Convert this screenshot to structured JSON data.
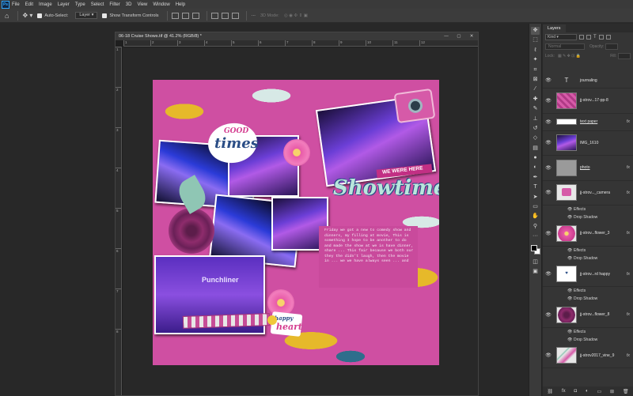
{
  "app": {
    "logo": "Ps",
    "accent": "#31a8ff"
  },
  "menu": [
    "File",
    "Edit",
    "Image",
    "Layer",
    "Type",
    "Select",
    "Filter",
    "3D",
    "View",
    "Window",
    "Help"
  ],
  "options_bar": {
    "auto_select_label": "Auto-Select:",
    "auto_select_value": "Layer",
    "transform_label": "Show Transform Controls",
    "mode_3d": "3D Mode:"
  },
  "document": {
    "tab_title": "06-18 Cruise Shows.tif @ 41.2% (RGB/8) *",
    "ruler_h": [
      "1",
      "2",
      "3",
      "4",
      "5",
      "6",
      "7",
      "8",
      "9",
      "10",
      "11",
      "12"
    ],
    "ruler_v": [
      "1",
      "2",
      "3",
      "4",
      "5",
      "6",
      "7",
      "8"
    ]
  },
  "canvas": {
    "sticker_good": "GOOD",
    "sticker_times": "times",
    "sticker_we_were_here": "WE WERE HERE",
    "sticker_showtime": "Showtime",
    "sign_punchliner": "Punchliner",
    "sticker_happy": "happy",
    "sticker_heart": "heart",
    "journal_text": "Friday we got a new to comedy show and dinners, my filling at movie, This is something I hope to be another to do and made the show at we is have dinner, share ... This fair because we both our they the didn't laugh, then the movie in ... we we have always seen ... and",
    "colors": {
      "pink": "#cf4fa2",
      "yellow": "#e6b92a",
      "teal": "#2e6e8c",
      "mint": "#d7e9e6"
    }
  },
  "layers_panel": {
    "tab": "Layers",
    "filter_kind": "Kind",
    "blend_mode": "Normal",
    "opacity_label": "Opacity:",
    "lock_label": "Lock:",
    "fill_label": "Fill:",
    "layers": [
      {
        "name": "journaling",
        "type": "text",
        "fx": ""
      },
      {
        "name": "jj-strov...17-pp-8",
        "type": "paper",
        "fx": ""
      },
      {
        "name": "text paper",
        "type": "white",
        "fx": "fx"
      },
      {
        "name": "IMG_1610",
        "type": "photo",
        "fx": ""
      },
      {
        "name": "photo",
        "type": "gray",
        "fx": "fx"
      },
      {
        "name": "jj-strov..._camera",
        "type": "camera",
        "fx": "fx",
        "effects": [
          "Effects",
          "Drop Shadow"
        ]
      },
      {
        "name": "jj-strov...flower_3",
        "type": "flower",
        "fx": "fx",
        "effects": [
          "Effects",
          "Drop Shadow"
        ]
      },
      {
        "name": "jj-strov...rd happy",
        "type": "happy",
        "fx": "fx",
        "effects": [
          "Effects",
          "Drop Shadow"
        ]
      },
      {
        "name": "jj-strov...flower_8",
        "type": "rose",
        "fx": "fx",
        "effects": [
          "Effects",
          "Drop Shadow"
        ]
      },
      {
        "name": "jj-strov2017_vine_9",
        "type": "vine",
        "fx": "fx"
      }
    ]
  },
  "tool_icons": [
    "move-icon",
    "marquee-icon",
    "lasso-icon",
    "magic-wand-icon",
    "crop-icon",
    "frame-icon",
    "eyedropper-icon",
    "healing-icon",
    "brush-icon",
    "stamp-icon",
    "history-brush-icon",
    "eraser-icon",
    "gradient-icon",
    "blur-icon",
    "dodge-icon",
    "pen-icon",
    "type-icon",
    "path-select-icon",
    "rectangle-icon",
    "hand-icon",
    "zoom-icon",
    "more-icon"
  ]
}
